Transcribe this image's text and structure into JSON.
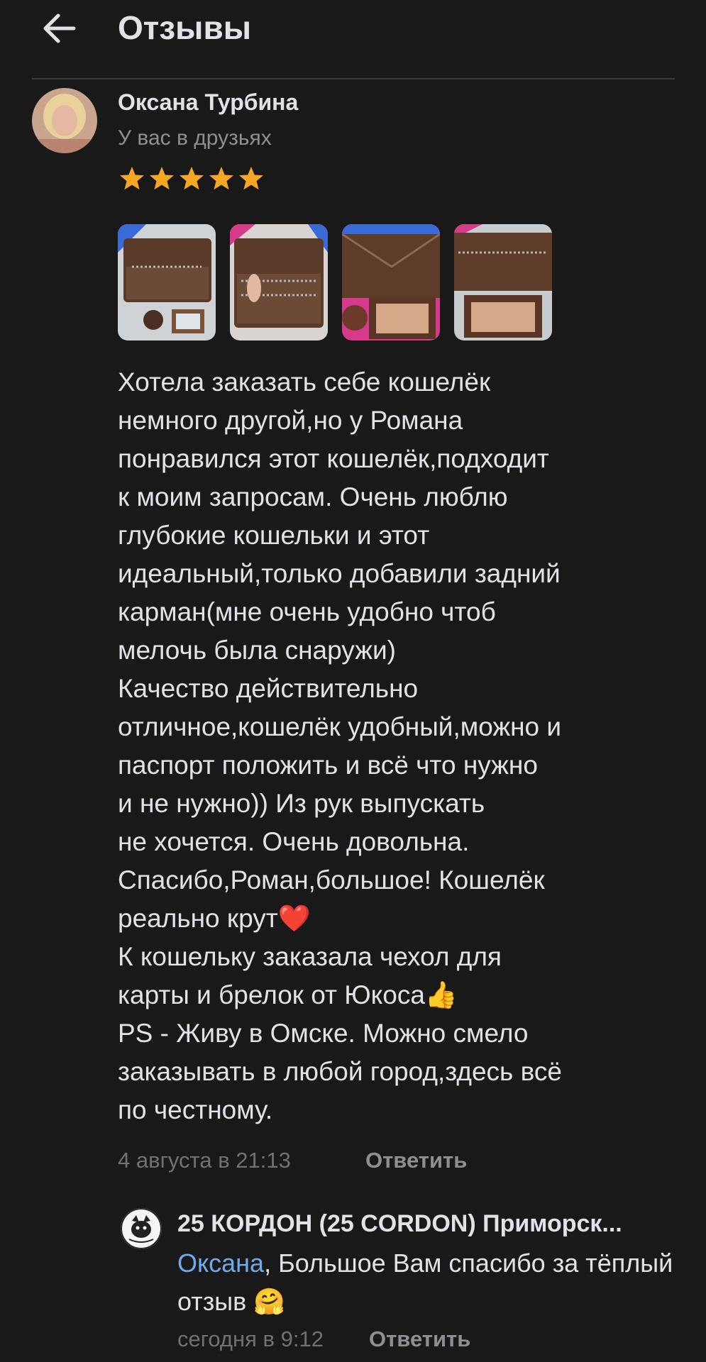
{
  "header": {
    "title": "Отзывы",
    "back_icon": "arrow-left-icon"
  },
  "review": {
    "author": "Оксана Турбина",
    "friend_status": "У вас в друзьях",
    "rating": 5,
    "rating_max": 5,
    "star_color": "#f5a623",
    "photos_count": 4,
    "text_lines": [
      "Хотела заказать себе кошелёк",
      "немного другой,но у Романа",
      "понравился этот кошелёк,подходит",
      "к моим запросам. Очень люблю",
      "глубокие кошельки и этот",
      "идеальный,только добавили задний",
      "карман(мне очень удобно чтоб",
      "мелочь была снаружи)",
      "Качество действительно",
      "отличное,кошелёк удобный,можно и",
      "паспорт положить и всё что нужно",
      "и не нужно)) Из рук выпускать",
      "не хочется. Очень довольна.",
      "Спасибо,Роман,большое!  Кошелёк",
      "реально крут❤️",
      "К кошельку заказала чехол для",
      "карты и брелок от Юкоса👍",
      "PS -  Живу в Омске. Можно смело",
      "заказывать в любой город,здесь всё",
      "по честному."
    ],
    "date": "4 августа в 21:13",
    "reply_label": "Ответить"
  },
  "shop_reply": {
    "shop_name": "25 КОРДОН (25 CORDON) Приморск...",
    "logo_text": "25 CORDON",
    "mention": "Оксана",
    "text": ", Большое Вам спасибо за тёплый отзыв 🤗",
    "date": "сегодня в 9:12",
    "reply_label": "Ответить"
  },
  "colors": {
    "background": "#19191a",
    "link": "#71aaeb",
    "secondary": "#8d8f93"
  }
}
